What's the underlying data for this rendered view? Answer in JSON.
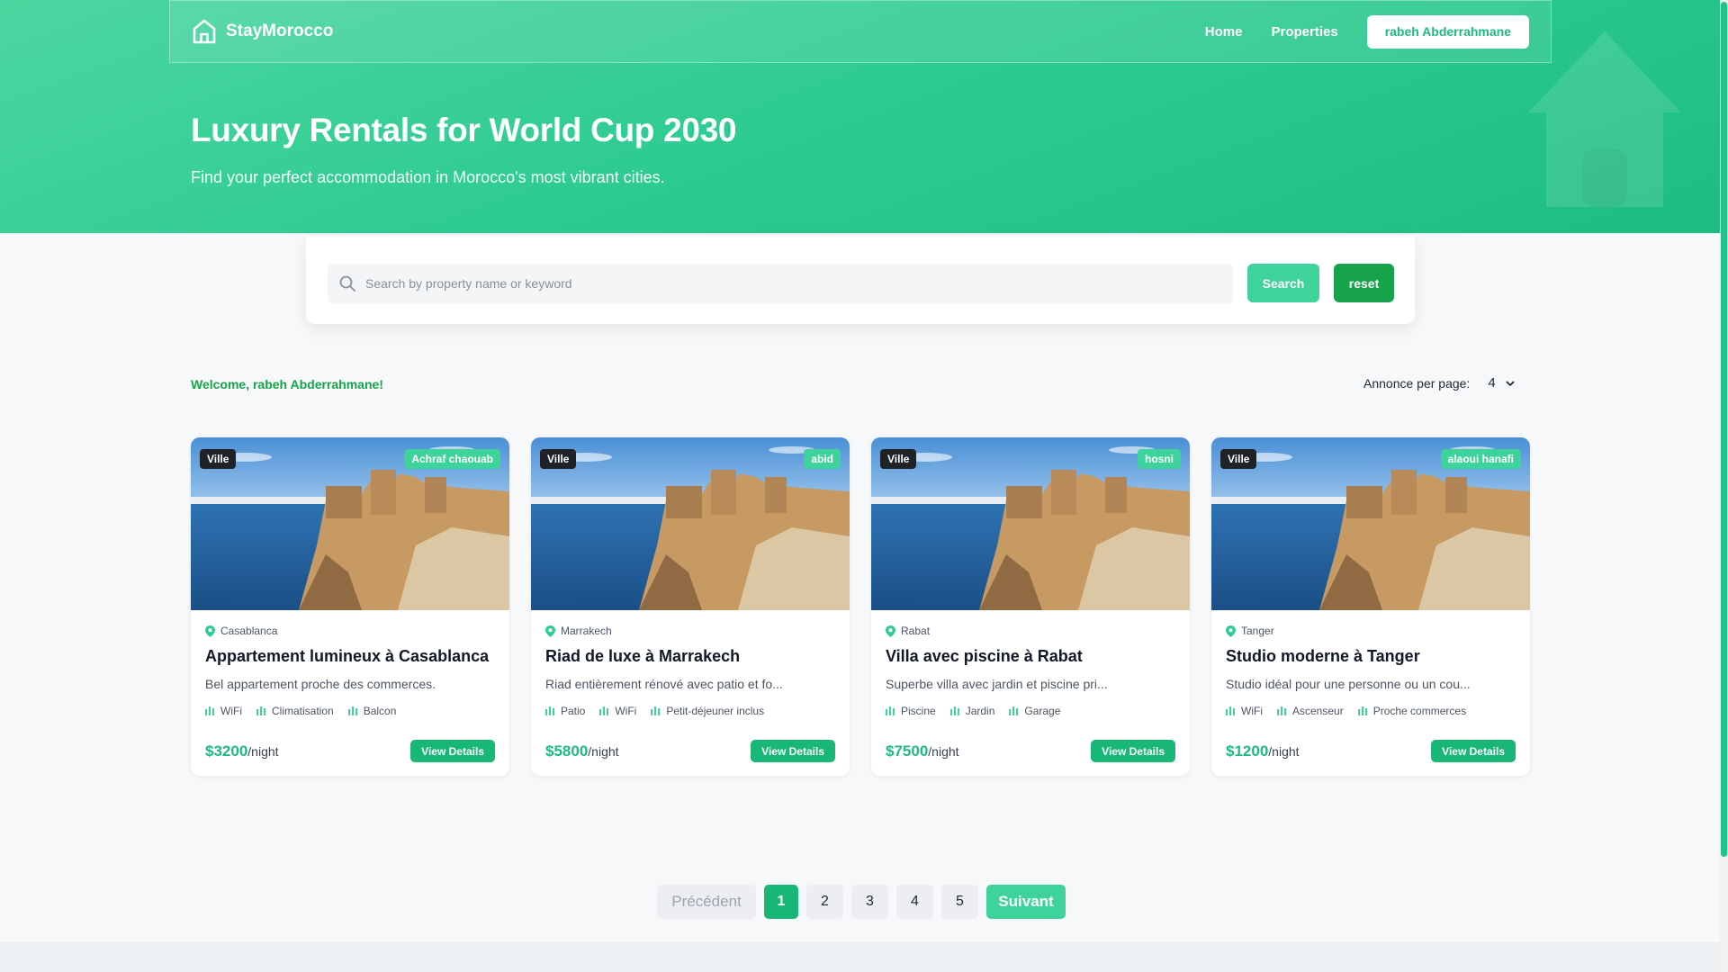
{
  "brand": {
    "name": "StayMorocco"
  },
  "nav": {
    "home": "Home",
    "properties": "Properties",
    "user": "rabeh Abderrahmane"
  },
  "hero": {
    "title": "Luxury Rentals for World Cup 2030",
    "subtitle": "Find your perfect accommodation in Morocco's most vibrant cities."
  },
  "search": {
    "placeholder": "Search by property name or keyword",
    "search_label": "Search",
    "reset_label": "reset"
  },
  "welcome": "Welcome, rabeh Abderrahmane!",
  "perpage": {
    "label": "Annonce per page:",
    "value": "4"
  },
  "cards": [
    {
      "badge": "Ville",
      "owner": "Achraf chaouab",
      "city": "Casablanca",
      "title": "Appartement lumineux à Casablanca",
      "desc": "Bel appartement proche des commerces.",
      "amenities": [
        "WiFi",
        "Climatisation",
        "Balcon"
      ],
      "price": "$3200",
      "unit": "/night",
      "cta": "View Details"
    },
    {
      "badge": "Ville",
      "owner": "abid",
      "city": "Marrakech",
      "title": "Riad de luxe à Marrakech",
      "desc": "Riad entièrement rénové avec patio et fo...",
      "amenities": [
        "Patio",
        "WiFi",
        "Petit-déjeuner inclus"
      ],
      "price": "$5800",
      "unit": "/night",
      "cta": "View Details"
    },
    {
      "badge": "Ville",
      "owner": "hosni",
      "city": "Rabat",
      "title": "Villa avec piscine à Rabat",
      "desc": "Superbe villa avec jardin et piscine pri...",
      "amenities": [
        "Piscine",
        "Jardin",
        "Garage"
      ],
      "price": "$7500",
      "unit": "/night",
      "cta": "View Details"
    },
    {
      "badge": "Ville",
      "owner": "alaoui hanafi",
      "city": "Tanger",
      "title": "Studio moderne à Tanger",
      "desc": "Studio idéal pour une personne ou un cou...",
      "amenities": [
        "WiFi",
        "Ascenseur",
        "Proche commerces"
      ],
      "price": "$1200",
      "unit": "/night",
      "cta": "View Details"
    }
  ],
  "pagination": {
    "prev": "Précédent",
    "pages": [
      "1",
      "2",
      "3",
      "4",
      "5"
    ],
    "next": "Suivant",
    "current": "1"
  },
  "colors": {
    "primary": "#2fcc92",
    "dark_green": "#16a34a",
    "button_green": "#18b777"
  }
}
